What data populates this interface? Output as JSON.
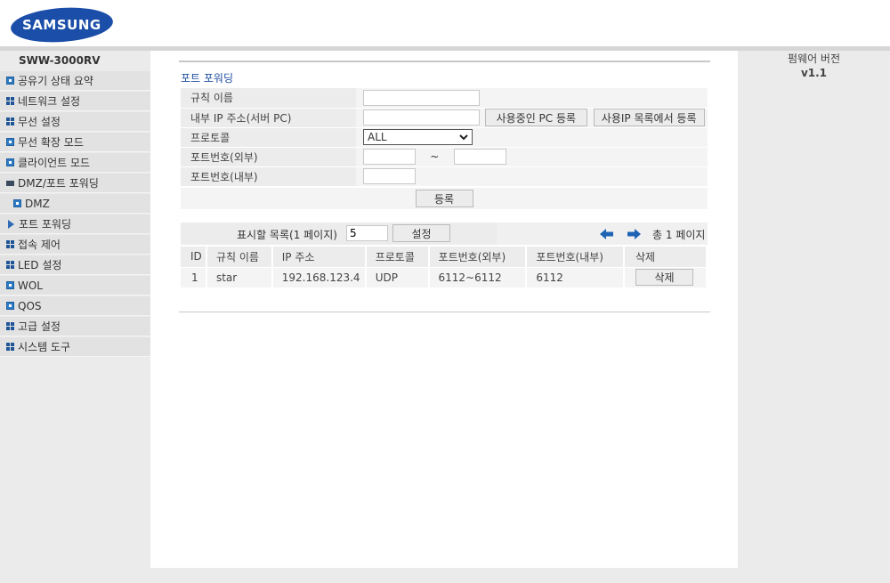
{
  "brand": {
    "logo_text": "SAMSUNG",
    "color": "#1a4ea8"
  },
  "sidebar": {
    "model": "SWW-3000RV",
    "items": [
      {
        "label": "공유기 상태 요약",
        "icon": "plus-square-icon"
      },
      {
        "label": "네트워크 설정",
        "icon": "grid-icon"
      },
      {
        "label": "무선 설정",
        "icon": "grid-icon"
      },
      {
        "label": "무선 확장 모드",
        "icon": "plus-square-icon"
      },
      {
        "label": "클라이언트 모드",
        "icon": "plus-square-icon"
      },
      {
        "label": "DMZ/포트 포워딩",
        "icon": "minus-icon"
      },
      {
        "label": "DMZ",
        "icon": "plus-square-icon"
      },
      {
        "label": "포트 포워딩",
        "icon": "arrow-right-icon"
      },
      {
        "label": "접속 제어",
        "icon": "grid-icon"
      },
      {
        "label": "LED 설정",
        "icon": "grid-icon"
      },
      {
        "label": "WOL",
        "icon": "plus-square-icon"
      },
      {
        "label": "QOS",
        "icon": "plus-square-icon"
      },
      {
        "label": "고급 설정",
        "icon": "grid-icon"
      },
      {
        "label": "시스템 도구",
        "icon": "grid-icon"
      }
    ]
  },
  "firmware": {
    "label": "펌웨어 버전",
    "version": "v1.1"
  },
  "main": {
    "title": "포트 포워딩",
    "form": {
      "rule_name_label": "규칙 이름",
      "rule_name_value": "",
      "internal_ip_label": "내부 IP 주소(서버 PC)",
      "internal_ip_value": "",
      "btn_register_used_pc": "사용중인 PC 등록",
      "btn_register_from_list": "사용IP 목록에서 등록",
      "protocol_label": "프로토콜",
      "protocol_selected": "ALL",
      "ext_port_label": "포트번호(외부)",
      "ext_port_from": "",
      "ext_port_to": "",
      "range_sep": "~",
      "int_port_label": "포트번호(내부)",
      "int_port_value": "",
      "register_button": "등록"
    },
    "list_bar": {
      "display_label": "표시할 목록(1 페이지)",
      "display_value": "5",
      "set_button": "설정",
      "page_info": "총 1 페이지"
    },
    "table": {
      "headers": [
        "ID",
        "규칙 이름",
        "IP 주소",
        "프로토콜",
        "포트번호(외부)",
        "포트번호(내부)",
        "삭제"
      ],
      "rows": [
        {
          "id": "1",
          "name": "star",
          "ip": "192.168.123.4",
          "protocol": "UDP",
          "ext": "6112~6112",
          "int": "6112",
          "delete": "삭제"
        }
      ]
    }
  }
}
